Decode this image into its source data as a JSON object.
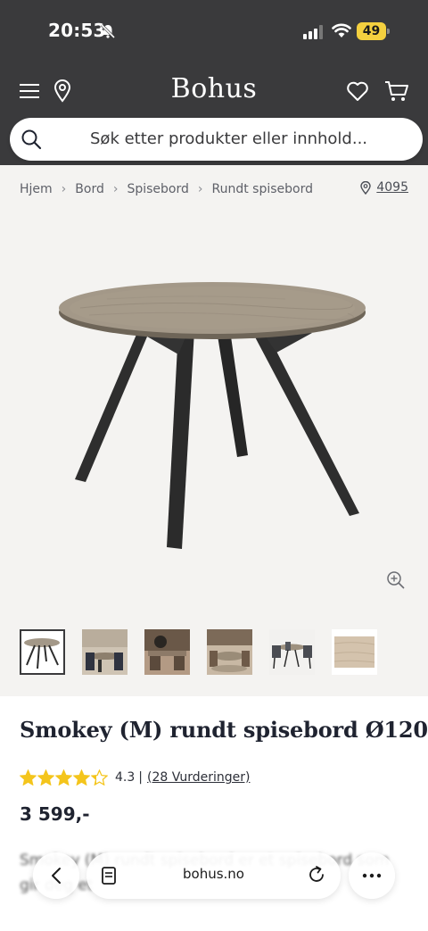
{
  "status_bar": {
    "time": "20:53",
    "battery": "49"
  },
  "header": {
    "brand": "Bohus",
    "search_placeholder": "Søk etter produkter eller innhold..."
  },
  "breadcrumb": {
    "items": [
      "Hjem",
      "Bord",
      "Spisebord",
      "Rundt spisebord"
    ],
    "store_number": "4095"
  },
  "gallery": {
    "thumbnail_count": 6,
    "active_index": 0
  },
  "product": {
    "title": "Smokey (M) rundt spisebord Ø120",
    "rating_value": 4.3,
    "rating_text": "4.3",
    "rating_separator": "|",
    "reviews_label": "(28 Vurderinger)",
    "price": "3 599,-",
    "description_partial": "Smokey (M) rundt spisebord er et spisebord som gir deg et"
  },
  "browser": {
    "url": "bohus.no"
  },
  "colors": {
    "header_bg": "#3a3a3c",
    "star": "#f4c51c",
    "image_bg": "#f4f3f1"
  }
}
